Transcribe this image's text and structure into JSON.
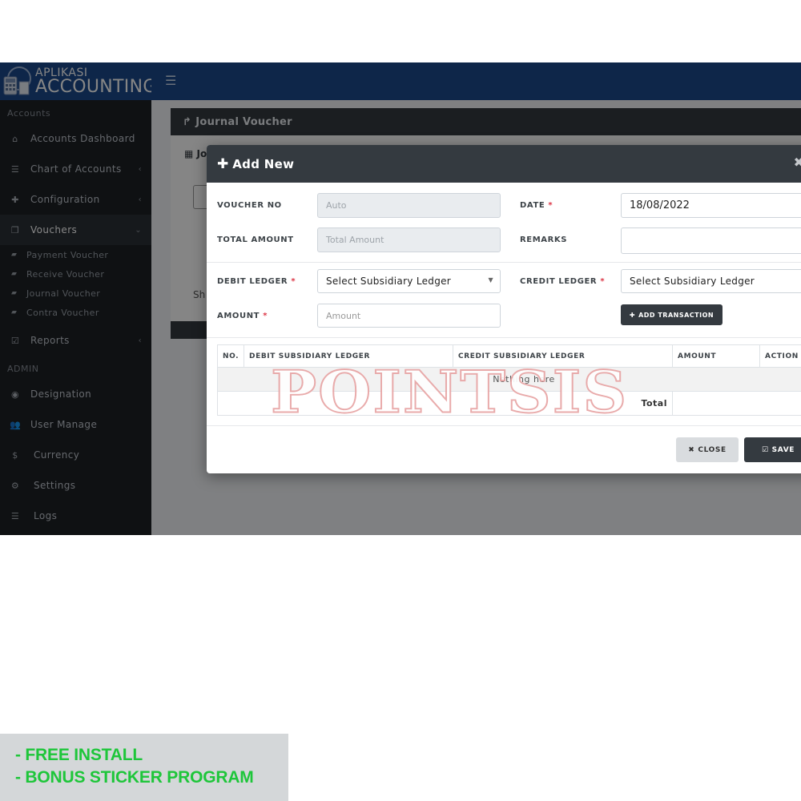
{
  "logo": {
    "top_text": "APLIKASI",
    "main_text": "ACCOUNTING"
  },
  "sidebar": {
    "section_accounts": "Accounts",
    "items": [
      {
        "label": "Accounts Dashboard",
        "icon": "home-icon"
      },
      {
        "label": "Chart of Accounts",
        "icon": "list-icon"
      },
      {
        "label": "Configuration",
        "icon": "puzzle-icon"
      },
      {
        "label": "Vouchers",
        "icon": "copy-icon"
      }
    ],
    "voucher_sub_items": [
      {
        "label": "Payment Voucher"
      },
      {
        "label": "Receive Voucher"
      },
      {
        "label": "Journal Voucher"
      },
      {
        "label": "Contra Voucher"
      }
    ],
    "reports_label": "Reports",
    "section_admin": "ADMIN",
    "admin_items": [
      {
        "label": "Designation",
        "icon": "user-circle-icon"
      },
      {
        "label": "User Manage",
        "icon": "users-icon"
      },
      {
        "label": "Currency",
        "icon": "dollar-icon"
      },
      {
        "label": "Settings",
        "icon": "gears-icon"
      },
      {
        "label": "Logs",
        "icon": "list-icon"
      }
    ]
  },
  "page": {
    "card_title": "Journal Voucher",
    "inner_title": "Jo",
    "inner_sh": "Sh"
  },
  "modal": {
    "title": "Add New",
    "voucher_no": {
      "label": "VOUCHER NO",
      "placeholder": "Auto"
    },
    "date": {
      "label": "DATE",
      "value": "18/08/2022"
    },
    "total_amount": {
      "label": "TOTAL AMOUNT",
      "placeholder": "Total Amount"
    },
    "remarks": {
      "label": "REMARKS",
      "value": ""
    },
    "debit_ledger": {
      "label": "DEBIT LEDGER",
      "selected": "Select Subsidiary Ledger"
    },
    "credit_ledger": {
      "label": "CREDIT LEDGER",
      "selected": "Select Subsidiary Ledger"
    },
    "amount": {
      "label": "AMOUNT",
      "placeholder": "Amount"
    },
    "add_transaction_label": "ADD TRANSACTION",
    "table": {
      "headers": [
        "NO.",
        "DEBIT SUBSIDIARY LEDGER",
        "CREDIT SUBSIDIARY LEDGER",
        "AMOUNT",
        "ACTION"
      ],
      "empty_text": "Nothing here",
      "total_label": "Total"
    },
    "close_label": "CLOSE",
    "save_label": "SAVE"
  },
  "watermark": "POINTSIS",
  "promo": [
    "- FREE INSTALL",
    "- BONUS STICKER PROGRAM"
  ]
}
